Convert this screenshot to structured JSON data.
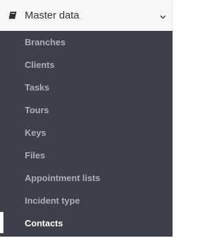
{
  "master_data": {
    "label": "Master data",
    "icon": "book-icon",
    "expand_icon": "chevron-down-icon",
    "expanded": true
  },
  "submenu": {
    "items": [
      {
        "label": "Branches",
        "active": false
      },
      {
        "label": "Clients",
        "active": false
      },
      {
        "label": "Tasks",
        "active": false
      },
      {
        "label": "Tours",
        "active": false
      },
      {
        "label": "Keys",
        "active": false
      },
      {
        "label": "Files",
        "active": false
      },
      {
        "label": "Appointment lists",
        "active": false
      },
      {
        "label": "Incident type",
        "active": false
      },
      {
        "label": "Contacts",
        "active": true
      }
    ]
  },
  "colors": {
    "sidebar_bg": "#3d404a",
    "header_bg": "#f7f7f7",
    "item_text": "#a9afbb",
    "active_text": "#ffffff"
  }
}
